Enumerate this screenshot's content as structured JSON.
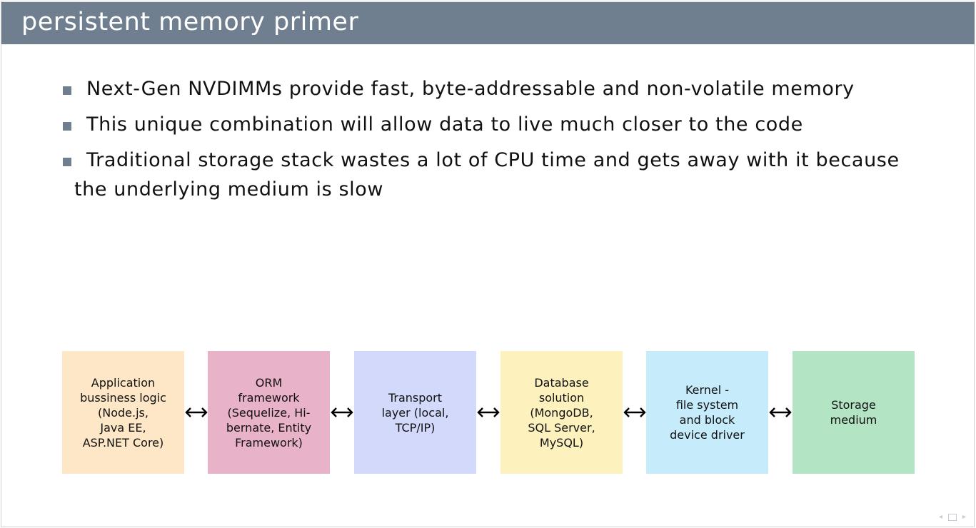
{
  "slide": {
    "title": "persistent memory primer",
    "bullets": [
      "Next-Gen NVDIMMs provide fast, byte-addressable and non-volatile memory",
      "This unique combination will allow data to live much closer to the code",
      "Traditional storage stack wastes a lot of CPU time and gets away with it because"
    ],
    "bullet_3_continuation": "the underlying medium is slow"
  },
  "diagram": {
    "boxes": [
      {
        "label": "Application\nbussiness logic\n(Node.js,\nJava EE,\nASP.NET Core)",
        "color": "#fde7c6"
      },
      {
        "label": "ORM\nframework\n(Sequelize, Hi-\nbernate, Entity\nFramework)",
        "color": "#e8b2c8"
      },
      {
        "label": "Transport\nlayer (local,\nTCP/IP)",
        "color": "#d2d9fb"
      },
      {
        "label": "Database\nsolution\n(MongoDB,\nSQL Server,\nMySQL)",
        "color": "#fdf1bd"
      },
      {
        "label": "Kernel -\nfile system\nand block\ndevice driver",
        "color": "#c6ecfb"
      },
      {
        "label": "Storage\nmedium",
        "color": "#b3e5c5"
      }
    ]
  },
  "nav": {
    "icons": [
      "prev-arrow-icon",
      "frame-icon",
      "next-arrow-icon"
    ]
  }
}
